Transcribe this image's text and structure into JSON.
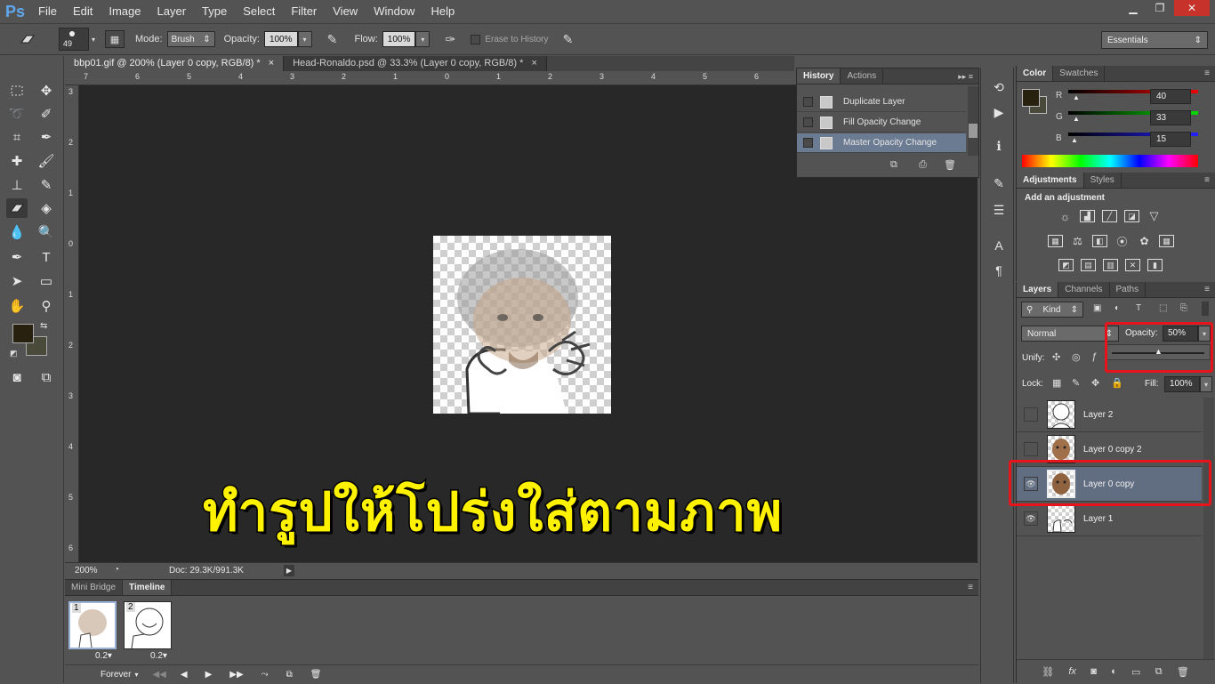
{
  "app": {
    "logo": "Ps"
  },
  "menu": [
    "File",
    "Edit",
    "Image",
    "Layer",
    "Type",
    "Select",
    "Filter",
    "View",
    "Window",
    "Help"
  ],
  "window_controls": {
    "minimize": "▁",
    "restore": "❐",
    "close": "✕"
  },
  "options": {
    "brush_size": "49",
    "mode_label": "Mode:",
    "mode_value": "Brush",
    "opacity_label": "Opacity:",
    "opacity_value": "100%",
    "flow_label": "Flow:",
    "flow_value": "100%",
    "erase_history_label": "Erase to History",
    "workspace": "Essentials"
  },
  "tabs": [
    {
      "label": "bbp01.gif @ 200% (Layer 0 copy, RGB/8) *",
      "close": "×"
    },
    {
      "label": "Head-Ronaldo.psd @ 33.3% (Layer 0 copy, RGB/8) *",
      "close": "×"
    }
  ],
  "ruler_h": [
    "7",
    "6",
    "5",
    "4",
    "3",
    "2",
    "1",
    "0",
    "1",
    "2",
    "3",
    "4",
    "5",
    "6",
    "7"
  ],
  "ruler_v": [
    "3",
    "2",
    "1",
    "0",
    "1",
    "2",
    "3",
    "4",
    "5",
    "6"
  ],
  "status": {
    "zoom": "200%",
    "doc": "Doc: 29.3K/991.3K"
  },
  "history": {
    "tabs": [
      "History",
      "Actions"
    ],
    "items": [
      "Duplicate Layer",
      "Fill Opacity Change",
      "Master Opacity Change"
    ],
    "active_index": 2
  },
  "color": {
    "tabs": [
      "Color",
      "Swatches"
    ],
    "channels": [
      {
        "label": "R",
        "value": "40"
      },
      {
        "label": "G",
        "value": "33"
      },
      {
        "label": "B",
        "value": "15"
      }
    ],
    "foreground": "#28210f"
  },
  "adjustments": {
    "tabs": [
      "Adjustments",
      "Styles"
    ],
    "heading": "Add an adjustment"
  },
  "layers": {
    "tabs": [
      "Layers",
      "Channels",
      "Paths"
    ],
    "kind": "Kind",
    "blend": "Normal",
    "opacity_label": "Opacity:",
    "opacity_value": "50%",
    "unify_label": "Unify:",
    "lock_label": "Lock:",
    "fill_label": "Fill:",
    "fill_value": "100%",
    "items": [
      {
        "name": "Layer 2",
        "visible": false
      },
      {
        "name": "Layer 0 copy 2",
        "visible": false
      },
      {
        "name": "Layer 0 copy",
        "visible": true,
        "active": true
      },
      {
        "name": "Layer 1",
        "visible": true
      }
    ]
  },
  "timeline": {
    "tabs": [
      "Mini Bridge",
      "Timeline"
    ],
    "frames": [
      {
        "num": "1",
        "delay": "0.2▾"
      },
      {
        "num": "2",
        "delay": "0.2▾"
      }
    ],
    "loop": "Forever"
  },
  "overlay_text": "ทำรูปให้โปร่งใส่ตามภาพ",
  "colors": {
    "highlight": "#e8141b",
    "overlay_text": "#fff200"
  }
}
